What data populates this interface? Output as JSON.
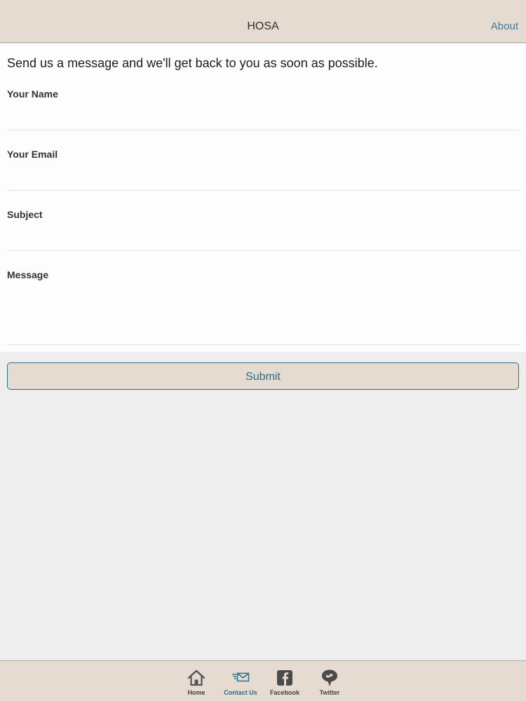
{
  "navbar": {
    "title": "HOSA",
    "about_label": "About"
  },
  "form": {
    "intro": "Send us a message and we'll get back to you as soon as possible.",
    "name_label": "Your Name",
    "name_value": "",
    "email_label": "Your Email",
    "email_value": "",
    "subject_label": "Subject",
    "subject_value": "",
    "message_label": "Message",
    "message_value": "",
    "submit_label": "Submit"
  },
  "tabs": [
    {
      "label": "Home",
      "icon": "home-icon",
      "active": false
    },
    {
      "label": "Contact Us",
      "icon": "mail-icon",
      "active": true
    },
    {
      "label": "Facebook",
      "icon": "facebook-icon",
      "active": false
    },
    {
      "label": "Twitter",
      "icon": "twitter-icon",
      "active": false
    }
  ],
  "colors": {
    "bar": "#e5dbd0",
    "accent": "#2f6c86",
    "background": "#efeeee"
  }
}
